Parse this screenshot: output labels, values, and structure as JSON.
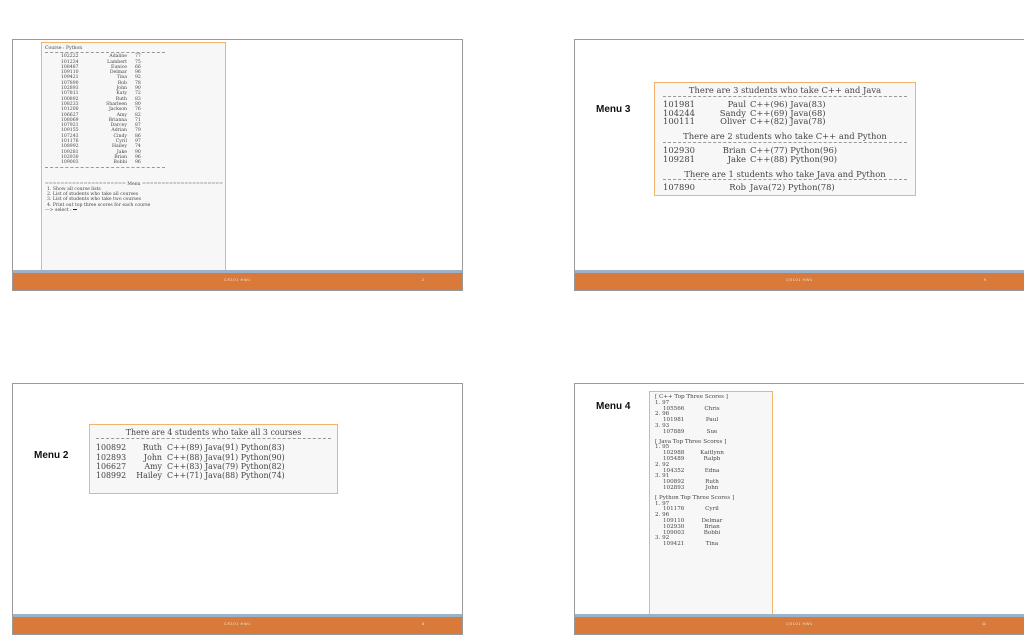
{
  "slides": {
    "s1": {
      "course_header": "Course : Python",
      "rows": [
        [
          "102222",
          "Adaline",
          "77"
        ],
        [
          "101234",
          "Lambert",
          "75"
        ],
        [
          "108487",
          "Eunice",
          "66"
        ],
        [
          "109110",
          "Delmar",
          "96"
        ],
        [
          "109421",
          "Tina",
          "92"
        ],
        [
          "107890",
          "Rob",
          "78"
        ],
        [
          "102893",
          "John",
          "90"
        ],
        [
          "107811",
          "Katy",
          "72"
        ],
        [
          "100892",
          "Ruth",
          "83"
        ],
        [
          "108233",
          "Sharleen",
          "80"
        ],
        [
          "101200",
          "Jackson",
          "76"
        ],
        [
          "106627",
          "Amy",
          "82"
        ],
        [
          "108069",
          "Brianna",
          "71"
        ],
        [
          "107921",
          "Darcey",
          "87"
        ],
        [
          "109155",
          "Adrian",
          "79"
        ],
        [
          "107243",
          "Cindy",
          "86"
        ],
        [
          "101176",
          "Cyril",
          "97"
        ],
        [
          "108992",
          "Hailey",
          "74"
        ],
        [
          "109281",
          "Jake",
          "90"
        ],
        [
          "102930",
          "Brian",
          "96"
        ],
        [
          "109003",
          "Bobbi",
          "96"
        ]
      ],
      "menu_header": "===================== Menu =====================",
      "menu_items": [
        "1. Show all course lists",
        "2. List of students who take all courses",
        "3. List of students who take two courses",
        "4. Print out top three scores for each course"
      ],
      "prompt": "---> select : ",
      "footer": "CS101 HW1",
      "page": "2"
    },
    "s2": {
      "label": "Menu 3",
      "sections": [
        {
          "title": "There are 3 students who take C++ and Java",
          "rows": [
            [
              "101981",
              "Paul",
              "C++(96) Java(83)"
            ],
            [
              "104244",
              "Sandy",
              "C++(69) Java(68)"
            ],
            [
              "100111",
              "Oliver",
              "C++(82) Java(78)"
            ]
          ]
        },
        {
          "title": "There are 2 students who take C++ and Python",
          "rows": [
            [
              "102930",
              "Brian",
              "C++(77) Python(96)"
            ],
            [
              "109281",
              "Jake",
              "C++(88) Python(90)"
            ]
          ]
        },
        {
          "title": "There are 1 students who take Java and Python",
          "rows": [
            [
              "107890",
              "Rob",
              "Java(72) Python(78)"
            ]
          ]
        }
      ],
      "footer": "CS101 HW1",
      "page": "9"
    },
    "s3": {
      "label": "Menu 2",
      "title": "There are 4 students who take all 3 courses",
      "rows": [
        [
          "100892",
          "Ruth",
          "C++(89) Java(91) Python(83)"
        ],
        [
          "102893",
          "John",
          "C++(88) Java(91) Python(90)"
        ],
        [
          "106627",
          "Amy",
          "C++(83) Java(79) Python(82)"
        ],
        [
          "108992",
          "Hailey",
          "C++(71) Java(88) Python(74)"
        ]
      ],
      "footer": "CS101 HW1",
      "page": "8"
    },
    "s4": {
      "label": "Menu 4",
      "groups": [
        {
          "title": "[ C++ Top Three Scores ]",
          "ranks": [
            {
              "rank": "1. 97",
              "students": [
                [
                  "105566",
                  "Chris"
                ]
              ]
            },
            {
              "rank": "2. 96",
              "students": [
                [
                  "101981",
                  "Paul"
                ]
              ]
            },
            {
              "rank": "3. 93",
              "students": [
                [
                  "107889",
                  "Sue"
                ]
              ]
            }
          ]
        },
        {
          "title": "[ Java Top Three Scores ]",
          "ranks": [
            {
              "rank": "1. 95",
              "students": [
                [
                  "102988",
                  "Kaitlynn"
                ],
                [
                  "105489",
                  "Ralph"
                ]
              ]
            },
            {
              "rank": "2. 92",
              "students": [
                [
                  "104352",
                  "Edna"
                ]
              ]
            },
            {
              "rank": "3. 91",
              "students": [
                [
                  "100892",
                  "Ruth"
                ],
                [
                  "102893",
                  "John"
                ]
              ]
            }
          ]
        },
        {
          "title": "[ Python Top Three Scores ]",
          "ranks": [
            {
              "rank": "1. 97",
              "students": [
                [
                  "101176",
                  "Cyril"
                ]
              ]
            },
            {
              "rank": "2. 96",
              "students": [
                [
                  "109110",
                  "Delmar"
                ],
                [
                  "102930",
                  "Brian"
                ],
                [
                  "109003",
                  "Bobbi"
                ]
              ]
            },
            {
              "rank": "3. 92",
              "students": [
                [
                  "109421",
                  "Tina"
                ]
              ]
            }
          ]
        }
      ],
      "footer": "CS101 HW1",
      "page": "11"
    }
  }
}
